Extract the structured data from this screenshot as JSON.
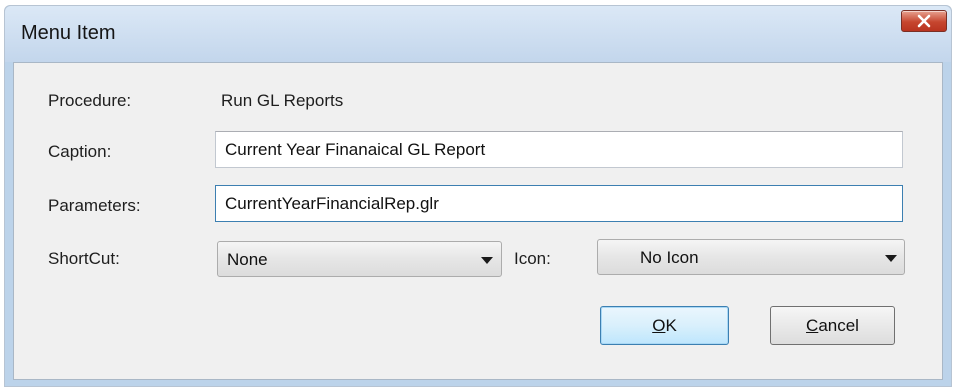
{
  "window": {
    "title": "Menu Item",
    "close_icon": "close-icon"
  },
  "form": {
    "procedure_label": "Procedure:",
    "procedure_value": "Run GL Reports",
    "caption_label": "Caption:",
    "caption_value": "Current Year Finanaical GL Report",
    "parameters_label": "Parameters:",
    "parameters_value": "CurrentYearFinancialRep.glr",
    "shortcut_label": "ShortCut:",
    "shortcut_value": "None",
    "icon_label": "Icon:",
    "icon_value": "No Icon"
  },
  "buttons": {
    "ok_mnemonic": "O",
    "ok_rest": "K",
    "cancel_mnemonic": "C",
    "cancel_rest": "ancel"
  },
  "colors": {
    "frame": "#bcd3ea",
    "client": "#f0f0f0",
    "close_button": "#c6462f",
    "focus_border": "#3c7fb1"
  }
}
